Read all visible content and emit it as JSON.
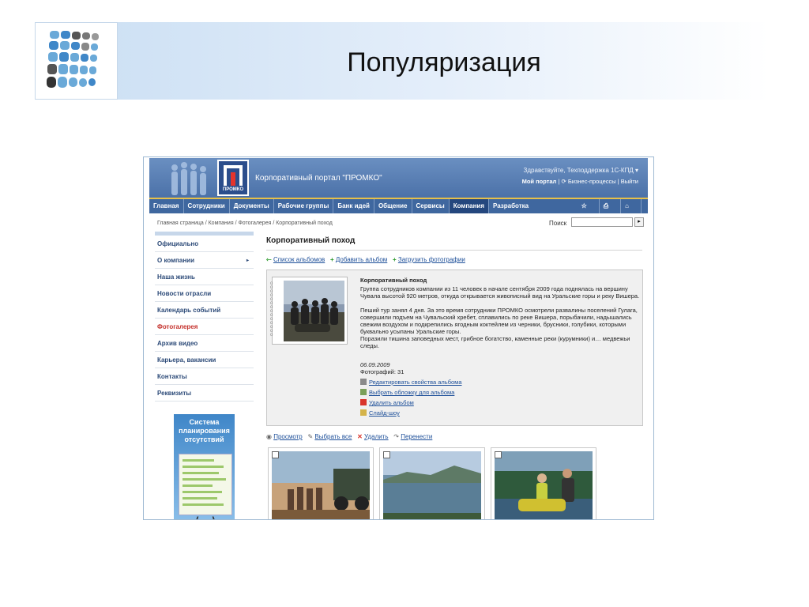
{
  "slide": {
    "title": "Популяризация"
  },
  "portal": {
    "title": "Корпоративный портал \"ПРОМКО\"",
    "logo_text": "ПРОМКО",
    "greeting": "Здравствуйте, Техподдержка 1С-КПД ▾",
    "top_links": {
      "my_portal": "Мой портал",
      "business": "Бизнес-процессы",
      "logout": "Выйти"
    }
  },
  "nav": {
    "items": [
      "Главная",
      "Сотрудники",
      "Документы",
      "Рабочие группы",
      "Банк идей",
      "Общение",
      "Сервисы",
      "Компания",
      "Разработка"
    ],
    "active": "Компания"
  },
  "breadcrumb": "Главная страница / Компания / Фотогалерея / Корпоративный поход",
  "search": {
    "label": "Поиск",
    "value": "",
    "button": "▸"
  },
  "sidebar": {
    "items": [
      "Официально",
      "О компании",
      "Наша жизнь",
      "Новости отрасли",
      "Календарь событий",
      "Фотогалерея",
      "Архив видео",
      "Карьера, вакансии",
      "Контакты",
      "Реквизиты"
    ],
    "active": "Фотогалерея",
    "banner_text": "Система планирования отсутствий"
  },
  "content": {
    "title": "Корпоративный поход",
    "links": {
      "albums": "Список альбомов",
      "add_album": "Добавить альбом",
      "upload": "Загрузить фотографии"
    },
    "album": {
      "title": "Корпоративный поход",
      "desc": "Группа сотрудников компании из 11 человек в начале сентября 2009 года поднялась на вершину Чувала высотой 920 метров, откуда открывается живописный вид на Уральские горы и реку Вишера.\n\nПеший тур занял 4 дня. За это время сотрудники ПРОМКО осмотрели развалины поселений Гулага, совершили подъем на Чувальский хребет, сплавились по реке Вишера, порыбачили, надышались свежим воздухом и подкрепились ягодным коктейлем из черники, брусники, голубики, которыми буквально усыпаны Уральские горы.\nПоразили тишина заповедных мест, грибное богатство, каменные реки (курумники) и… медвежьи следы.",
      "date": "06.09.2009",
      "count": "Фотографий: 31",
      "actions": [
        "Редактировать свойства альбома",
        "Выбрать обложку для альбома",
        "Удалить альбом",
        "Слайд-шоу"
      ]
    },
    "photo_actions": {
      "view": "Просмотр",
      "select_all": "Выбрать все",
      "delete": "Удалить",
      "move": "Перенести"
    }
  }
}
